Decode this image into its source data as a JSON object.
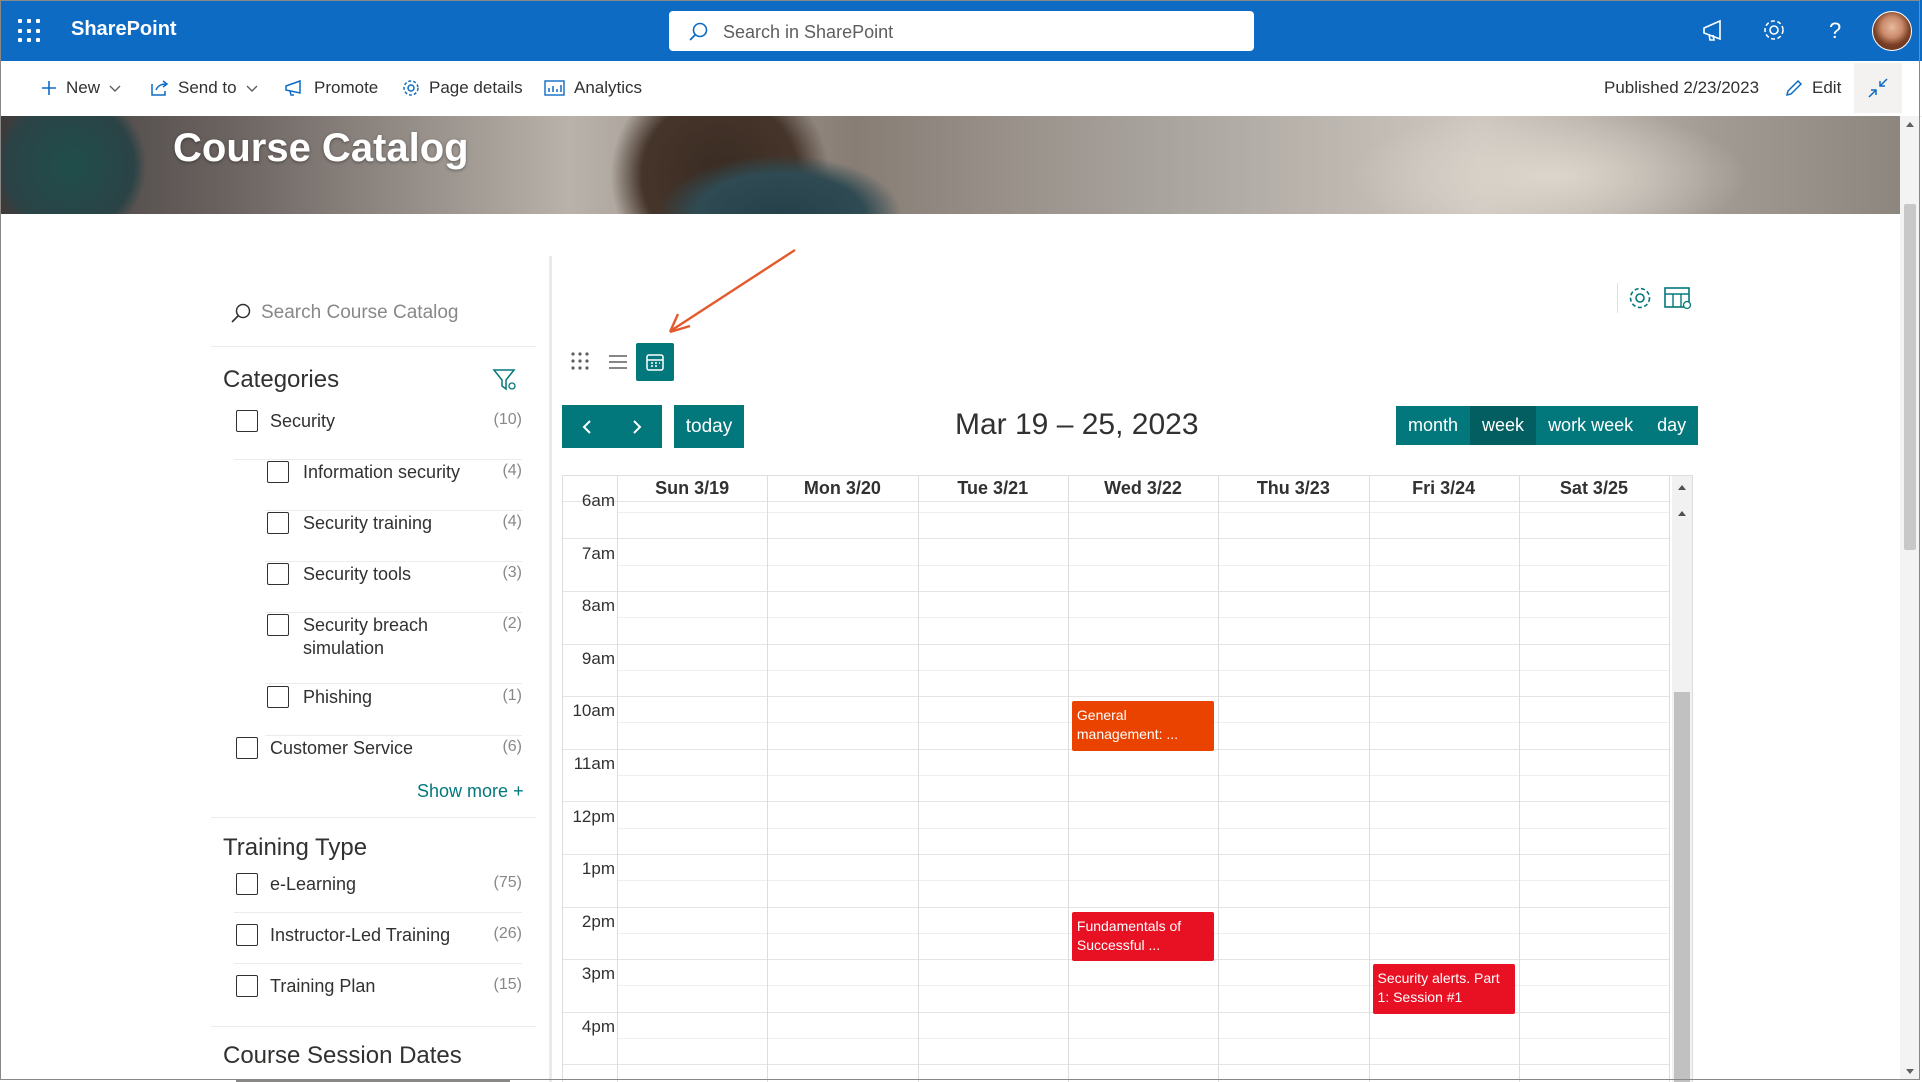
{
  "suite": {
    "brand": "SharePoint",
    "search_placeholder": "Search in SharePoint"
  },
  "commandbar": {
    "new": "New",
    "send_to": "Send to",
    "promote": "Promote",
    "page_details": "Page details",
    "analytics": "Analytics",
    "published": "Published 2/23/2023",
    "edit": "Edit"
  },
  "hero": {
    "title": "Course Catalog"
  },
  "filters": {
    "search_placeholder": "Search Course Catalog",
    "categories_title": "Categories",
    "categories": [
      {
        "label": "Security",
        "count": "(10)"
      },
      {
        "label": "Information security",
        "count": "(4)"
      },
      {
        "label": "Security training",
        "count": "(4)"
      },
      {
        "label": "Security tools",
        "count": "(3)"
      },
      {
        "label": "Security breach simulation",
        "count": "(2)"
      },
      {
        "label": "Phishing",
        "count": "(1)"
      },
      {
        "label": "Customer Service",
        "count": "(6)"
      }
    ],
    "show_more": "Show more",
    "training_type_title": "Training Type",
    "training_types": [
      {
        "label": "e-Learning",
        "count": "(75)"
      },
      {
        "label": "Instructor-Led Training",
        "count": "(26)"
      },
      {
        "label": "Training Plan",
        "count": "(15)"
      }
    ],
    "session_dates_title": "Course Session Dates"
  },
  "calendar": {
    "today_label": "today",
    "range_title": "Mar 19 – 25, 2023",
    "views": [
      "month",
      "week",
      "work week",
      "day"
    ],
    "active_view": "week",
    "days": [
      "Sun 3/19",
      "Mon 3/20",
      "Tue 3/21",
      "Wed 3/22",
      "Thu 3/23",
      "Fri 3/24",
      "Sat 3/25"
    ],
    "times": [
      "6am",
      "7am",
      "8am",
      "9am",
      "10am",
      "11am",
      "12pm",
      "1pm",
      "2pm",
      "3pm",
      "4pm"
    ],
    "events": [
      {
        "title": "General management: ...",
        "day": "Wed 3/22",
        "start": "10am",
        "color": "#ea4300"
      },
      {
        "title": "Fundamentals of Successful ...",
        "day": "Wed 3/22",
        "start": "2pm",
        "color": "#e81123"
      },
      {
        "title": "Security alerts. Part 1: Session #1",
        "day": "Fri 3/24",
        "start": "3pm",
        "color": "#e81123"
      }
    ]
  },
  "colors": {
    "suite": "#0e6bc4",
    "accent": "#03787c"
  }
}
